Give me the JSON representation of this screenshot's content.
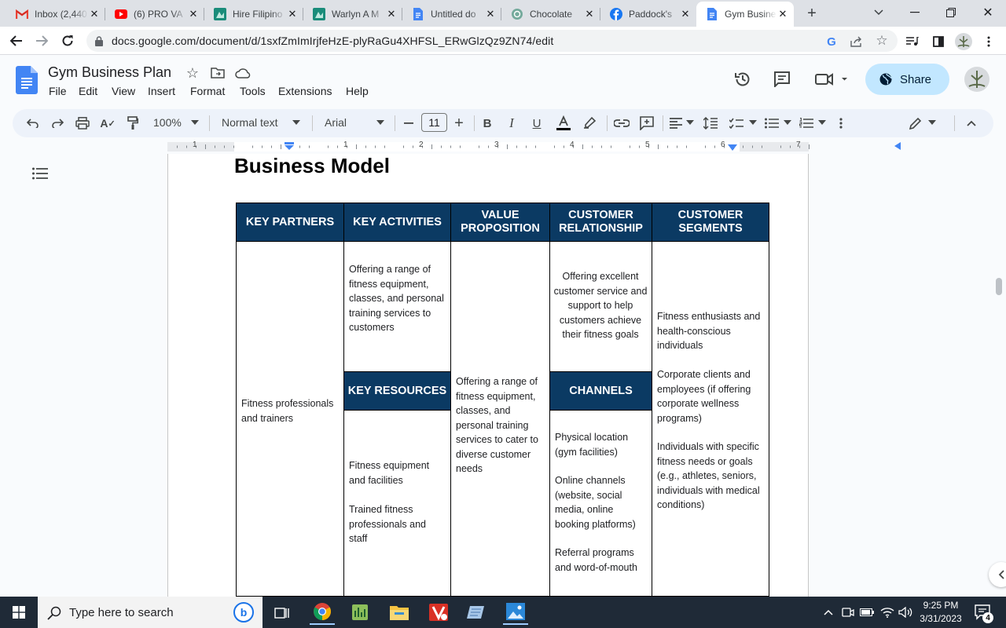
{
  "browser": {
    "tabs": [
      {
        "title": "Inbox (2,440",
        "icon": "gmail-icon"
      },
      {
        "title": "(6) PRO VA",
        "icon": "youtube-icon"
      },
      {
        "title": "Hire Filipino",
        "icon": "onlinejobs-icon"
      },
      {
        "title": "Warlyn A M",
        "icon": "onlinejobs-icon"
      },
      {
        "title": "Untitled do",
        "icon": "google-docs-icon"
      },
      {
        "title": "Chocolate",
        "icon": "chatgpt-icon"
      },
      {
        "title": "Paddock's",
        "icon": "facebook-icon"
      },
      {
        "title": "Gym Busine",
        "icon": "google-docs-icon",
        "active": true
      }
    ],
    "url": "docs.google.com/document/d/1sxfZmImIrjfeHzE-plyRaGu4XHFSL_ERwGlzQz9ZN74/edit"
  },
  "doc": {
    "title": "Gym Business Plan",
    "menu": [
      "File",
      "Edit",
      "View",
      "Insert",
      "Format",
      "Tools",
      "Extensions",
      "Help"
    ],
    "share_label": "Share",
    "toolbar": {
      "zoom": "100%",
      "style": "Normal text",
      "font": "Arial",
      "font_size": "11"
    },
    "ruler_numbers": [
      "1",
      "1",
      "2",
      "3",
      "4",
      "5",
      "6",
      "7"
    ],
    "heading": "Business Model",
    "canvas": {
      "headers": {
        "key_partners": "KEY PARTNERS",
        "key_activities": "KEY ACTIVITIES",
        "value_proposition": "VALUE PROPOSITION",
        "customer_relationship": "CUSTOMER RELATIONSHIP",
        "customer_segments": "CUSTOMER SEGMENTS",
        "key_resources": "KEY RESOURCES",
        "channels": "CHANNELS"
      },
      "key_partners": [
        "Fitness professionals and trainers"
      ],
      "key_activities": [
        "Offering a range of fitness equipment, classes, and personal training services to customers"
      ],
      "key_resources": [
        "Fitness equipment and facilities",
        "Trained fitness professionals and staff"
      ],
      "value_proposition": [
        "Offering a range of fitness equipment, classes, and personal training services to cater to diverse customer needs"
      ],
      "customer_relationship": [
        "Offering excellent customer service and support to help customers achieve their fitness goals"
      ],
      "channels": [
        "Physical location (gym facilities)",
        "Online channels (website, social media, online booking platforms)",
        "Referral programs and word-of-mouth"
      ],
      "customer_segments": [
        "Fitness enthusiasts and health-conscious individuals",
        "Corporate clients and employees (if offering corporate wellness programs)",
        "Individuals with specific fitness needs or goals (e.g., athletes, seniors, individuals with medical conditions)"
      ]
    }
  },
  "taskbar": {
    "search_placeholder": "Type here to search",
    "time": "9:25 PM",
    "date": "3/31/2023",
    "notification_count": "4"
  },
  "colors": {
    "header_fill": "#0b3a63",
    "share_bg": "#c2e7ff",
    "docs_blue": "#4285f4"
  }
}
